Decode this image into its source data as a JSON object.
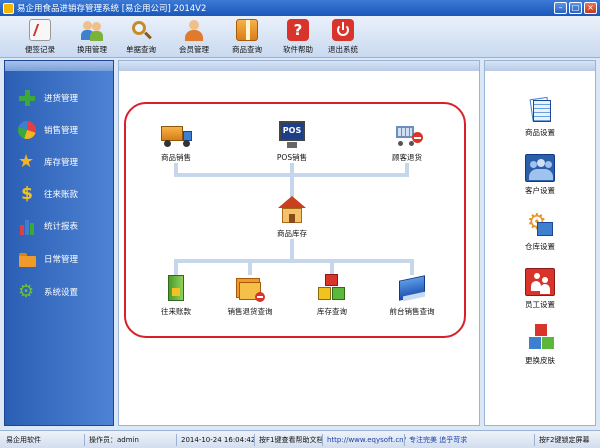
{
  "window": {
    "title": "易企用食品进销存管理系统 [易企用公司] 2014V2"
  },
  "toolbar": {
    "items": [
      {
        "label": "便签记录",
        "icon": "notepad-icon",
        "color": "#e8e8e8"
      },
      {
        "label": "换用管理",
        "icon": "users-icon",
        "color": "#7bb23b"
      },
      {
        "label": "单据查询",
        "icon": "magnifier-icon",
        "color": "#f2c14e"
      },
      {
        "label": "会员管理",
        "icon": "members-icon",
        "color": "#e07a2e"
      },
      {
        "label": "商品查询",
        "icon": "box-icon",
        "color": "#e8942a"
      },
      {
        "label": "软件帮助",
        "icon": "help-icon",
        "color": "#d9342b"
      },
      {
        "label": "退出系统",
        "icon": "power-icon",
        "color": "#d9342b"
      }
    ]
  },
  "sidebar": {
    "items": [
      {
        "label": "进货管理",
        "icon": "plus-icon",
        "color": "#3aa83a"
      },
      {
        "label": "销售管理",
        "icon": "pie-chart-icon",
        "color": "#e0702a"
      },
      {
        "label": "库存管理",
        "icon": "star-icon",
        "color": "#f3b323"
      },
      {
        "label": "往来账款",
        "icon": "dollar-icon",
        "color": "#f2c31e"
      },
      {
        "label": "统计报表",
        "icon": "bar-chart-icon",
        "color": "#e04040"
      },
      {
        "label": "日常管理",
        "icon": "folder-icon",
        "color": "#f09a2c"
      },
      {
        "label": "系统设置",
        "icon": "gear-icon",
        "color": "#6cbf3a"
      }
    ]
  },
  "flow": {
    "top": [
      {
        "label": "商品销售",
        "icon": "truck-icon"
      },
      {
        "label": "POS销售",
        "icon": "pos-terminal-icon",
        "screen_text": "POS"
      },
      {
        "label": "顾客退货",
        "icon": "cart-return-icon"
      }
    ],
    "middle": {
      "label": "商品库存",
      "icon": "house-icon"
    },
    "bottom": [
      {
        "label": "往来账款",
        "icon": "ledger-icon"
      },
      {
        "label": "销售退货查询",
        "icon": "folders-icon"
      },
      {
        "label": "库存查询",
        "icon": "cubes-icon"
      },
      {
        "label": "前台销售查询",
        "icon": "binder-icon"
      }
    ]
  },
  "rightbar": {
    "items": [
      {
        "label": "商品设置",
        "icon": "document-stack-icon"
      },
      {
        "label": "客户设置",
        "icon": "group-icon"
      },
      {
        "label": "仓库设置",
        "icon": "warehouse-gear-icon"
      },
      {
        "label": "员工设置",
        "icon": "staff-icon"
      },
      {
        "label": "更换皮肤",
        "icon": "skin-cube-icon"
      }
    ]
  },
  "status": {
    "company": "易企用软件",
    "operator": "操作员：admin",
    "datetime": "2014-10-24 16:04:42",
    "help": "按F1键查看帮助文档",
    "url": "http://www.eqysoft.cn/",
    "slogan": "专注完美 追乎苛求",
    "lock": "按F2键锁定屏幕"
  }
}
